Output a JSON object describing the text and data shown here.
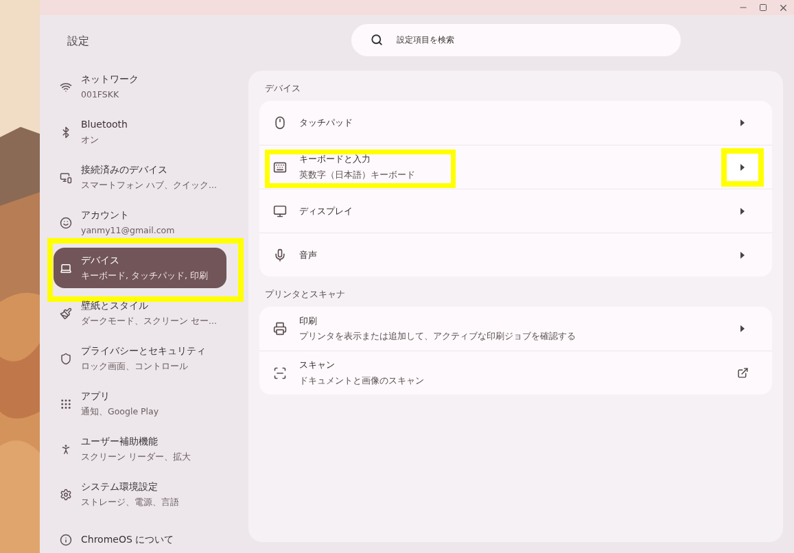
{
  "window": {
    "title": "設定"
  },
  "search": {
    "placeholder": "設定項目を検索"
  },
  "sidebar": {
    "items": [
      {
        "title": "ネットワーク",
        "subtitle": "001FSKK",
        "selected": false,
        "highlighted": false
      },
      {
        "title": "Bluetooth",
        "subtitle": "オン",
        "selected": false,
        "highlighted": false
      },
      {
        "title": "接続済みのデバイス",
        "subtitle": "スマートフォン ハブ、クイック...",
        "selected": false,
        "highlighted": false
      },
      {
        "title": "アカウント",
        "subtitle": "yanmy11@gmail.com",
        "selected": false,
        "highlighted": false
      },
      {
        "title": "デバイス",
        "subtitle": "キーボード, タッチパッド, 印刷",
        "selected": true,
        "highlighted": true
      },
      {
        "title": "壁紙とスタイル",
        "subtitle": "ダークモード、スクリーン セー...",
        "selected": false,
        "highlighted": false
      },
      {
        "title": "プライバシーとセキュリティ",
        "subtitle": "ロック画面、コントロール",
        "selected": false,
        "highlighted": false
      },
      {
        "title": "アプリ",
        "subtitle": "通知、Google Play",
        "selected": false,
        "highlighted": false
      },
      {
        "title": "ユーザー補助機能",
        "subtitle": "スクリーン リーダー、拡大",
        "selected": false,
        "highlighted": false
      },
      {
        "title": "システム環境設定",
        "subtitle": "ストレージ、電源、言語",
        "selected": false,
        "highlighted": false
      },
      {
        "title": "ChromeOS について",
        "selected": false,
        "highlighted": false
      }
    ]
  },
  "sections": [
    {
      "heading": "デバイス",
      "rows": [
        {
          "title": "タッチパッド",
          "kind": "chevron",
          "highlighted": false,
          "chevron_highlighted": false
        },
        {
          "title": "キーボードと入力",
          "subtitle": "英数字（日本語）キーボード",
          "kind": "chevron",
          "highlighted": true,
          "chevron_highlighted": true
        },
        {
          "title": "ディスプレイ",
          "kind": "chevron",
          "highlighted": false,
          "chevron_highlighted": false
        },
        {
          "title": "音声",
          "kind": "chevron",
          "highlighted": false,
          "chevron_highlighted": false
        }
      ]
    },
    {
      "heading": "プリンタとスキャナ",
      "rows": [
        {
          "title": "印刷",
          "subtitle": "プリンタを表示または追加して、アクティブな印刷ジョブを確認する",
          "kind": "chevron",
          "highlighted": false,
          "chevron_highlighted": false
        },
        {
          "title": "スキャン",
          "subtitle": "ドキュメントと画像のスキャン",
          "kind": "external",
          "highlighted": false
        }
      ]
    }
  ]
}
